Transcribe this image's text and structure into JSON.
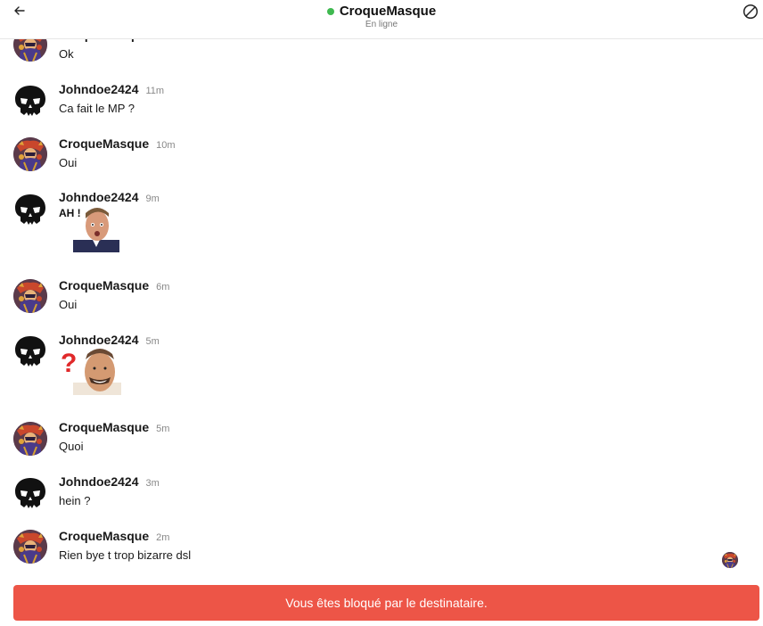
{
  "header": {
    "title": "CroqueMasque",
    "status": "En ligne",
    "back_icon": "arrow-left-icon",
    "block_icon": "block-icon",
    "status_color": "#3fb950"
  },
  "messages": [
    {
      "author": "CroqueMasque",
      "time": "",
      "text": "Ok",
      "avatar": "croquemasque"
    },
    {
      "author": "Johndoe2424",
      "time": "11m",
      "text": "Ca fait le MP ?",
      "avatar": "skull"
    },
    {
      "author": "CroqueMasque",
      "time": "10m",
      "text": "Oui",
      "avatar": "croquemasque"
    },
    {
      "author": "Johndoe2424",
      "time": "9m",
      "sticker": "AH !",
      "avatar": "skull"
    },
    {
      "author": "CroqueMasque",
      "time": "6m",
      "text": "Oui",
      "avatar": "croquemasque"
    },
    {
      "author": "Johndoe2424",
      "time": "5m",
      "sticker": "?",
      "avatar": "skull"
    },
    {
      "author": "CroqueMasque",
      "time": "5m",
      "text": "Quoi",
      "avatar": "croquemasque"
    },
    {
      "author": "Johndoe2424",
      "time": "3m",
      "text": "hein ?",
      "avatar": "skull"
    },
    {
      "author": "CroqueMasque",
      "time": "2m",
      "text": "Rien bye t trop bizarre dsl",
      "avatar": "croquemasque"
    }
  ],
  "footer": {
    "blocked_text": "Vous êtes bloqué par le destinataire.",
    "banner_color": "#ed5547"
  }
}
